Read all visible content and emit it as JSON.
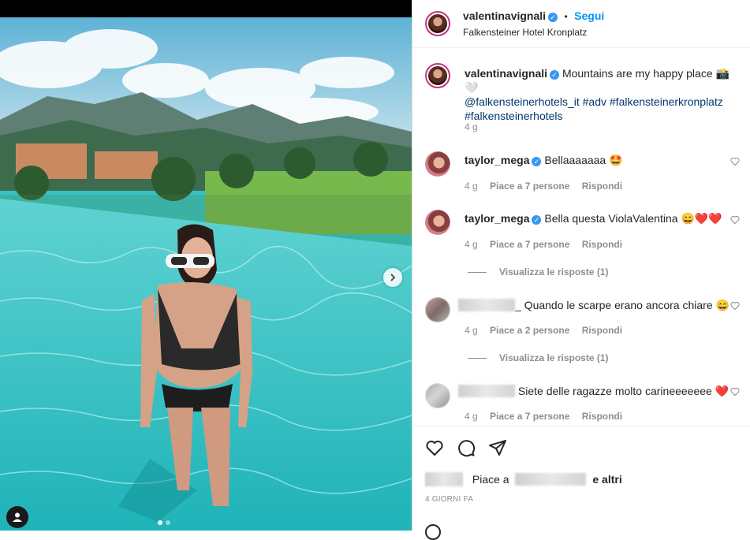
{
  "post": {
    "author": "valentinavignali",
    "follow_sep": "•",
    "follow_label": "Segui",
    "location": "Falkensteiner Hotel Kronplatz"
  },
  "caption": {
    "author": "valentinavignali",
    "text": "Mountains are my happy place",
    "emoji": "📸🤍",
    "mention": "@falkensteinerhotels_it",
    "tags_line1": "#adv #falkensteinerkronplatz",
    "tags_line2": "#falkensteinerhotels",
    "time": "4 g"
  },
  "comments": [
    {
      "author": "taylor_mega",
      "text": "Bellaaaaaaa",
      "emoji": "🤩",
      "time": "4 g",
      "likes": "Piace a 7 persone",
      "reply": "Rispondi"
    },
    {
      "author": "taylor_mega",
      "text": "Bella questa ViolaValentina",
      "emoji": "😄❤️❤️",
      "time": "4 g",
      "likes": "Piace a 7 persone",
      "reply": "Rispondi",
      "view_replies": "Visualizza le risposte (1)"
    },
    {
      "author_suffix": "_",
      "text": "Quando le scarpe erano ancora chiare",
      "emoji": "😄",
      "time": "4 g",
      "likes": "Piace a 2 persone",
      "reply": "Rispondi",
      "view_replies": "Visualizza le risposte (1)"
    },
    {
      "text": "Siete delle ragazze molto carineeeeeee",
      "emoji": "❤️",
      "time": "4 g",
      "likes": "Piace a 7 persone",
      "reply": "Rispondi"
    }
  ],
  "likes_summary": {
    "prefix": "Piace a",
    "suffix": "e altri"
  },
  "timestamp": "4 GIORNI FA",
  "icons": {
    "like": "heart-icon",
    "comment": "comment-icon",
    "share": "share-icon",
    "next": "chevron-right-icon",
    "tags": "user-tag-icon"
  },
  "colors": {
    "accent": "#0095f6",
    "verified": "#3897f0",
    "hashtag": "#00376b"
  }
}
